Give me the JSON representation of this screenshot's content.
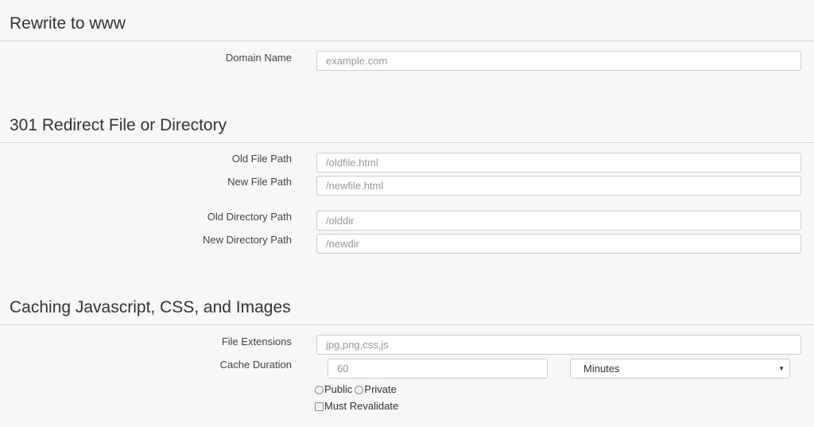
{
  "rewrite": {
    "title": "Rewrite to www",
    "domain_label": "Domain Name",
    "domain_placeholder": "example.com"
  },
  "redirect": {
    "title": "301 Redirect File or Directory",
    "old_file_label": "Old File Path",
    "old_file_placeholder": "/oldfile.html",
    "new_file_label": "New File Path",
    "new_file_placeholder": "/newfile.html",
    "old_dir_label": "Old Directory Path",
    "old_dir_placeholder": "/olddir",
    "new_dir_label": "New Directory Path",
    "new_dir_placeholder": "/newdir"
  },
  "caching": {
    "title": "Caching Javascript, CSS, and Images",
    "extensions_label": "File Extensions",
    "extensions_placeholder": "jpg,png,css,js",
    "duration_label": "Cache Duration",
    "duration_placeholder": "60",
    "duration_unit": "Minutes",
    "public_label": "Public",
    "private_label": "Private",
    "must_revalidate_label": "Must Revalidate"
  }
}
